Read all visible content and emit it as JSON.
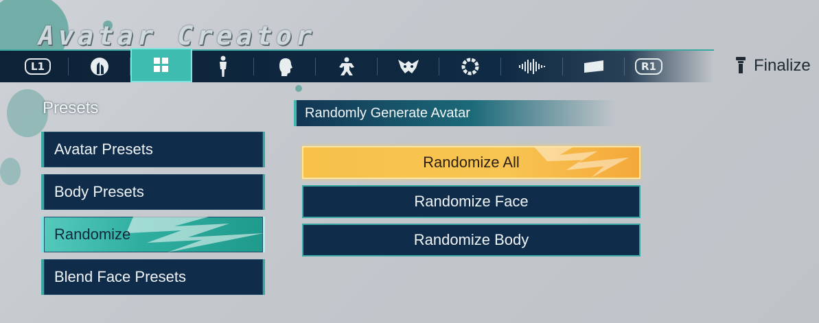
{
  "screen_title": "Avatar Creator",
  "topbar": {
    "left_badge": "L1",
    "right_badge": "R1",
    "tabs": [
      {
        "icon": "face-silhouette-icon"
      },
      {
        "icon": "grid-icon",
        "active": true
      },
      {
        "icon": "body-figure-icon"
      },
      {
        "icon": "head-profile-icon"
      },
      {
        "icon": "martial-figure-icon"
      },
      {
        "icon": "mask-icon"
      },
      {
        "icon": "ring-icon"
      },
      {
        "icon": "soundwave-icon"
      },
      {
        "icon": "card-icon"
      }
    ],
    "finalize_label": "Finalize"
  },
  "presets": {
    "heading": "Presets",
    "items": [
      {
        "label": "Avatar Presets"
      },
      {
        "label": "Body Presets"
      },
      {
        "label": "Randomize",
        "active": true
      },
      {
        "label": "Blend Face Presets"
      }
    ]
  },
  "randomize_panel": {
    "header": "Randomly Generate Avatar",
    "buttons": [
      {
        "label": "Randomize All",
        "active": true
      },
      {
        "label": "Randomize Face"
      },
      {
        "label": "Randomize Body"
      }
    ]
  },
  "colors": {
    "accent_teal": "#3fbcb0",
    "panel_navy": "#0f2d4a",
    "highlight_gold": "#f7c14a"
  }
}
